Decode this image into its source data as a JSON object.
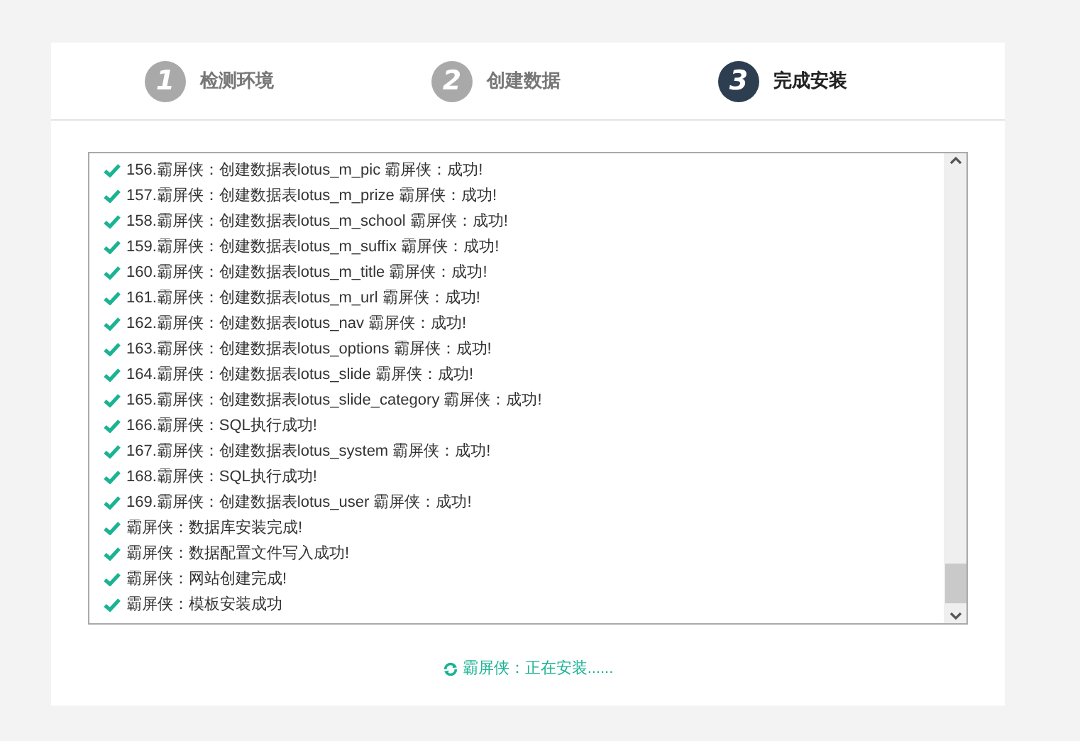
{
  "steps": [
    {
      "number": "1",
      "label": "检测环境",
      "selected": false
    },
    {
      "number": "2",
      "label": "创建数据",
      "selected": false
    },
    {
      "number": "3",
      "label": "完成安装",
      "selected": true
    }
  ],
  "log": [
    "156.霸屏侠：创建数据表lotus_m_pic 霸屏侠：成功!",
    "157.霸屏侠：创建数据表lotus_m_prize 霸屏侠：成功!",
    "158.霸屏侠：创建数据表lotus_m_school 霸屏侠：成功!",
    "159.霸屏侠：创建数据表lotus_m_suffix 霸屏侠：成功!",
    "160.霸屏侠：创建数据表lotus_m_title 霸屏侠：成功!",
    "161.霸屏侠：创建数据表lotus_m_url 霸屏侠：成功!",
    "162.霸屏侠：创建数据表lotus_nav 霸屏侠：成功!",
    "163.霸屏侠：创建数据表lotus_options 霸屏侠：成功!",
    "164.霸屏侠：创建数据表lotus_slide 霸屏侠：成功!",
    "165.霸屏侠：创建数据表lotus_slide_category 霸屏侠：成功!",
    "166.霸屏侠：SQL执行成功!",
    "167.霸屏侠：创建数据表lotus_system 霸屏侠：成功!",
    "168.霸屏侠：SQL执行成功!",
    "169.霸屏侠：创建数据表lotus_user 霸屏侠：成功!",
    "霸屏侠：数据库安装完成!",
    "霸屏侠：数据配置文件写入成功!",
    "霸屏侠：网站创建完成!",
    "霸屏侠：模板安装成功"
  ],
  "status": "霸屏侠：正在安装......"
}
